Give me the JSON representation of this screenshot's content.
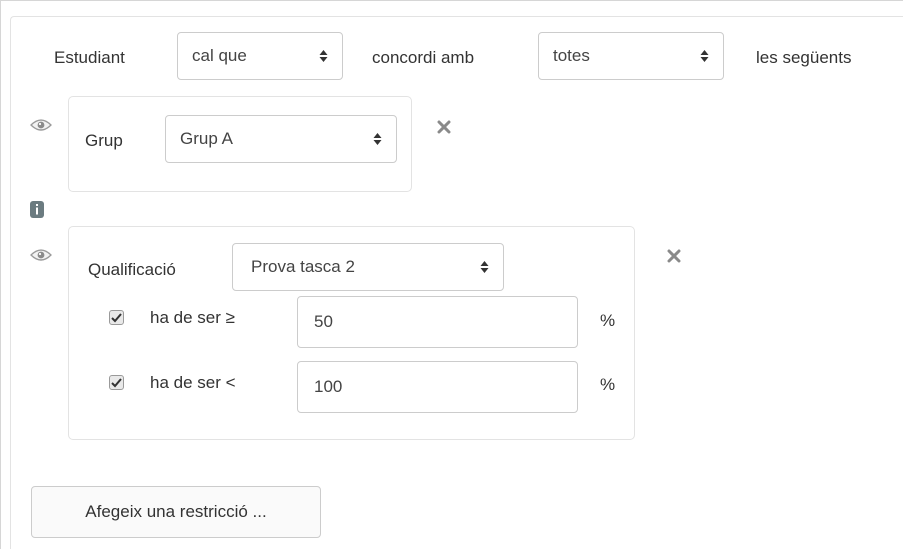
{
  "header": {
    "student_label": "Estudiant",
    "must_select_value": "cal que",
    "match_label": "concordi amb",
    "match_select_value": "totes",
    "following_label": "les següents"
  },
  "conditions": [
    {
      "type_label": "Grup",
      "select_value": "Grup A",
      "eye_icon": "eye-icon",
      "close_icon": "close-icon"
    },
    {
      "type_label": "Qualificació",
      "select_value": "Prova tasca 2",
      "eye_icon": "eye-icon",
      "close_icon": "close-icon",
      "rows": [
        {
          "checked": true,
          "label": "ha de ser ≥",
          "value": "50",
          "unit": "%"
        },
        {
          "checked": true,
          "label": "ha de ser <",
          "value": "100",
          "unit": "%"
        }
      ]
    }
  ],
  "info_icon": "info-icon",
  "add_button_label": "Afegeix una restricció ...",
  "colors": {
    "icon_grey": "#8a8a8a",
    "border": "#cccccc",
    "panel_border": "#e3e3e3"
  }
}
